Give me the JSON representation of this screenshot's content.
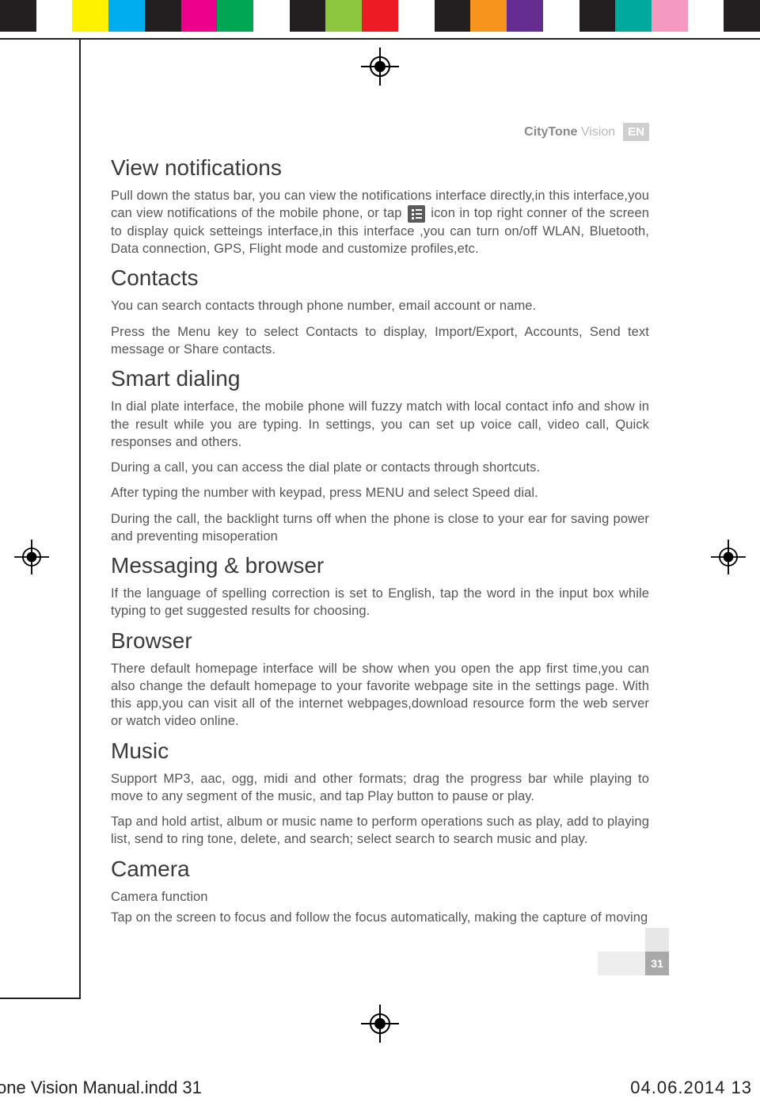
{
  "colorbar": [
    "#231f20",
    "#ffffff",
    "#fff200",
    "#00aeef",
    "#231f20",
    "#ec008c",
    "#00a651",
    "#ffffff",
    "#231f20",
    "#8dc63f",
    "#ed1c24",
    "#ffffff",
    "#231f20",
    "#f7941d",
    "#662d91",
    "#ffffff",
    "#231f20",
    "#00a99d",
    "#f49ac1",
    "#ffffff",
    "#231f20"
  ],
  "header": {
    "brand1": "CityTone",
    "brand2": "Vision",
    "lang": "EN"
  },
  "sections": {
    "s0": {
      "title": "View notifications",
      "p1a": "Pull down the status bar, you can view the notifications interface directly,in this interface,you can view notifications of the mobile phone, or tap ",
      "p1b": " icon in top right conner of the screen to display quick setteings interface,in this interface ,you can turn on/off WLAN, Bluetooth, Data connection, GPS, Flight mode and customize profiles,etc."
    },
    "s1": {
      "title": "Contacts",
      "p1": "You can search contacts through phone number, email account or name.",
      "p2": "Press the Menu key to select Contacts to display, Import/Export, Accounts, Send text message or Share contacts."
    },
    "s2": {
      "title": "Smart dialing",
      "p1": "In dial plate interface, the mobile phone will fuzzy match with local contact info and show in the result while you are typing. In settings, you can set up voice call, video call, Quick responses and others.",
      "p2": "During a call, you can access the dial plate or contacts through shortcuts.",
      "p3": "After typing the number with keypad, press MENU and select Speed dial.",
      "p4": "During the call, the backlight turns off when the phone is close to your ear for saving power and preventing misoperation"
    },
    "s3": {
      "title": "Messaging & browser",
      "p1": "If the language of spelling correction is set to English, tap the word in the input box while typing to get suggested results for choosing."
    },
    "s4": {
      "title": "Browser",
      "p1": "There default homepage interface will be show when you open the app first time,you can also change the default homepage to your favorite webpage site in the settings page. With this app,you can visit all of the internet webpages,download resource form the web server or watch video online."
    },
    "s5": {
      "title": "Music",
      "p1": "Support MP3, aac, ogg, midi and other formats; drag the progress bar while playing to move to any segment of the music, and tap Play button to pause or play.",
      "p2": "Tap and hold artist, album or music name to perform operations such as play, add to playing list, send to ring tone, delete, and search; select search to search music and play."
    },
    "s6": {
      "title": "Camera",
      "sub": "Camera function",
      "p1": "Tap on the screen to focus and follow the focus automatically, making the capture of moving"
    }
  },
  "page_number": "31",
  "slug": {
    "left": "one Vision Manual.indd   31",
    "right": "04.06.2014   13"
  }
}
